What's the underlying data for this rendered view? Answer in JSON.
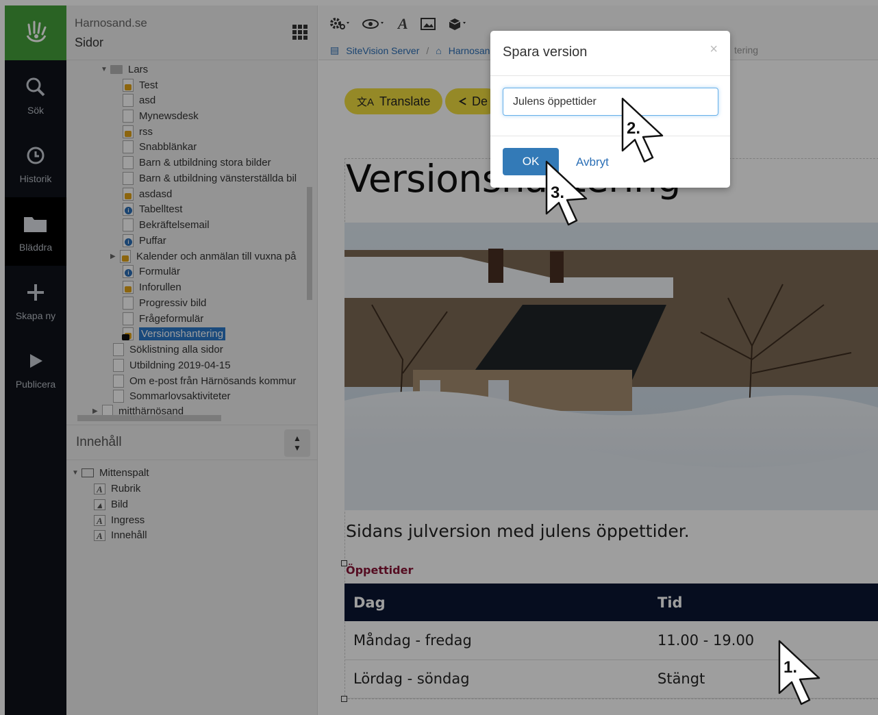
{
  "rail": {
    "items": [
      {
        "label": "Sök",
        "icon": "search-icon"
      },
      {
        "label": "Historik",
        "icon": "history-icon"
      },
      {
        "label": "Bläddra",
        "icon": "folder-icon"
      },
      {
        "label": "Skapa ny",
        "icon": "plus-icon"
      },
      {
        "label": "Publicera",
        "icon": "play-icon"
      }
    ]
  },
  "sidebar": {
    "site": "Harnosand.se",
    "section": "Sidor",
    "tree": {
      "folder": "Lars",
      "items": [
        "Test",
        "asd",
        "Mynewsdesk",
        "rss",
        "Snabblänkar",
        "Barn & utbildning stora bilder",
        "Barn & utbildning vänsterställda bil",
        "asdasd",
        "Tabelltest",
        "Bekräftelsemail",
        "Puffar",
        "Kalender och anmälan till vuxna på",
        "Formulär",
        "Inforullen",
        "Progressiv bild",
        "Frågeformulär",
        "Versionshantering"
      ],
      "siblings": [
        "Söklistning alla sidor",
        "Utbildning 2019-04-15",
        "Om e-post från Härnösands kommur",
        "Sommarlovsaktiviteter",
        "mitthärnösand"
      ]
    },
    "content_select": "Innehåll",
    "content_tree": {
      "root": "Mittenspalt",
      "items": [
        "Rubrik",
        "Bild",
        "Ingress",
        "Innehåll"
      ]
    }
  },
  "toolbar": {
    "breadcrumb": [
      "SiteVision Server",
      "Harnosand"
    ],
    "breadcrumb_tail": "tering"
  },
  "page": {
    "translate_label": "Translate",
    "share_label": "De",
    "title": "Versionshantering",
    "ingress": "Sidans julversion med julens öppettider.",
    "subheading": "Öppettider",
    "table": {
      "headers": [
        "Dag",
        "Tid"
      ],
      "rows": [
        [
          "Måndag - fredag",
          "11.00 - 19.00"
        ],
        [
          "Lördag - söndag",
          "Stängt"
        ]
      ]
    }
  },
  "modal": {
    "title": "Spara version",
    "close": "×",
    "input_value": "Julens öppettider",
    "ok_label": "OK",
    "cancel_label": "Avbryt"
  },
  "annotations": [
    "1.",
    "2.",
    "3."
  ],
  "colors": {
    "rail_bg": "#0f131a",
    "logo_green": "#44a13a",
    "pill_yellow": "#f0dd3f",
    "table_header": "#0b1633",
    "subhead": "#8a1538",
    "primary": "#337ab7"
  }
}
